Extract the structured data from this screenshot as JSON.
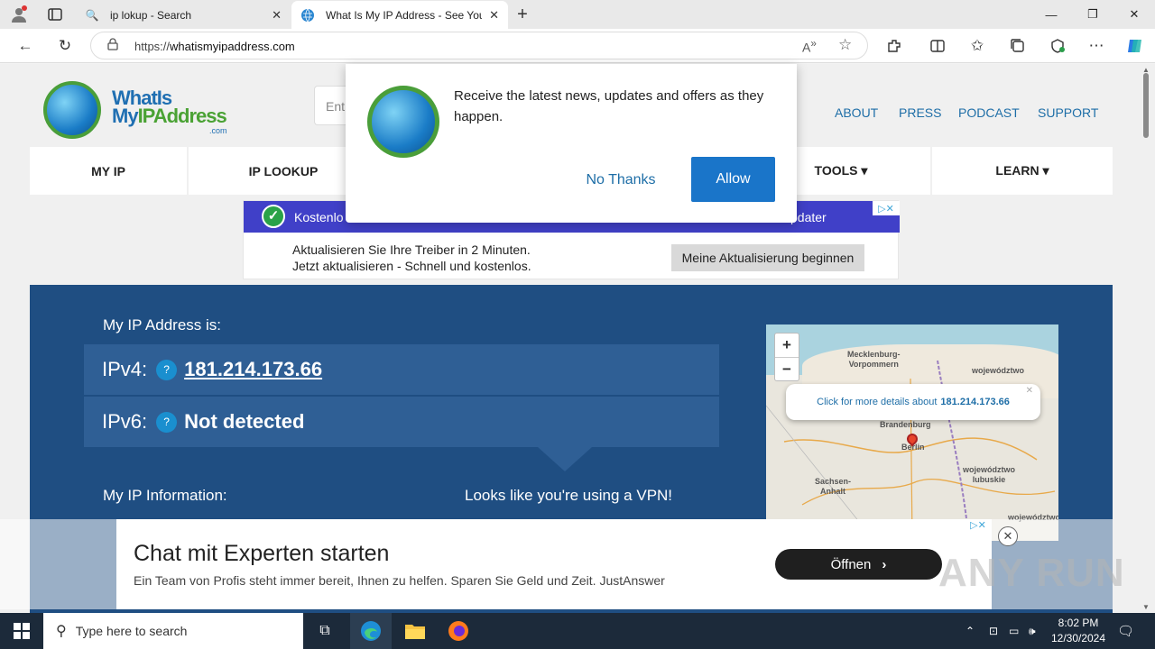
{
  "browser": {
    "tabs": [
      {
        "title": "ip lokup - Search",
        "close": "✕"
      },
      {
        "title": "What Is My IP Address - See Your",
        "close": "✕"
      }
    ],
    "new_tab": "+",
    "url_prefix": "https://",
    "url_domain": "whatismyipaddress.com",
    "window": {
      "minimize": "—",
      "maximize": "❐",
      "close": "✕"
    }
  },
  "site": {
    "logo": {
      "line1": "WhatIs",
      "line2a": "My",
      "line2b": "IPAddress",
      "line3": ".com"
    },
    "search_placeholder": "Ent",
    "top_links": [
      "ABOUT",
      "PRESS",
      "PODCAST",
      "SUPPORT"
    ],
    "nav": [
      "MY IP",
      "IP LOOKUP",
      "TOOLS ▾",
      "LEARN ▾"
    ]
  },
  "ad_top": {
    "band_left": "Kostenlo",
    "band_right": "pdater",
    "line1": "Aktualisieren Sie Ihre Treiber in 2 Minuten.",
    "line2": "Jetzt aktualisieren - Schnell und kostenlos.",
    "button": "Meine Aktualisierung beginnen",
    "choices": "▷✕"
  },
  "hero": {
    "my_ip_label": "My IP Address is:",
    "ipv4_label": "IPv4:",
    "ipv4_value": "181.214.173.66",
    "ipv6_label": "IPv6:",
    "ipv6_value": "Not detected",
    "help": "?",
    "info_label": "My IP Information:",
    "vpn_notice": "Looks like you're using a VPN!"
  },
  "map": {
    "zoom_in": "+",
    "zoom_out": "−",
    "popup_text": "Click for more details about",
    "popup_ip": "181.214.173.66",
    "popup_close": "✕",
    "labels": [
      "Mecklenburg-\nVorpommern",
      "województwo",
      "Brandenburg",
      "Berlin",
      "województwo\nlubuskie",
      "Sachsen-\nAnhalt",
      "województwo"
    ]
  },
  "notification": {
    "message": "Receive the latest news, updates and offers as they happen.",
    "no_thanks": "No Thanks",
    "allow": "Allow"
  },
  "ad_bottom": {
    "headline": "Chat mit Experten starten",
    "subline": "Ein Team von Profis steht immer bereit, Ihnen zu helfen. Sparen Sie Geld und Zeit. JustAnswer",
    "button": "Öffnen",
    "close": "✕",
    "choices": "▷✕"
  },
  "watermark": "ANY RUN",
  "taskbar": {
    "search_placeholder": "Type here to search",
    "time": "8:02 PM",
    "date": "12/30/2024"
  }
}
